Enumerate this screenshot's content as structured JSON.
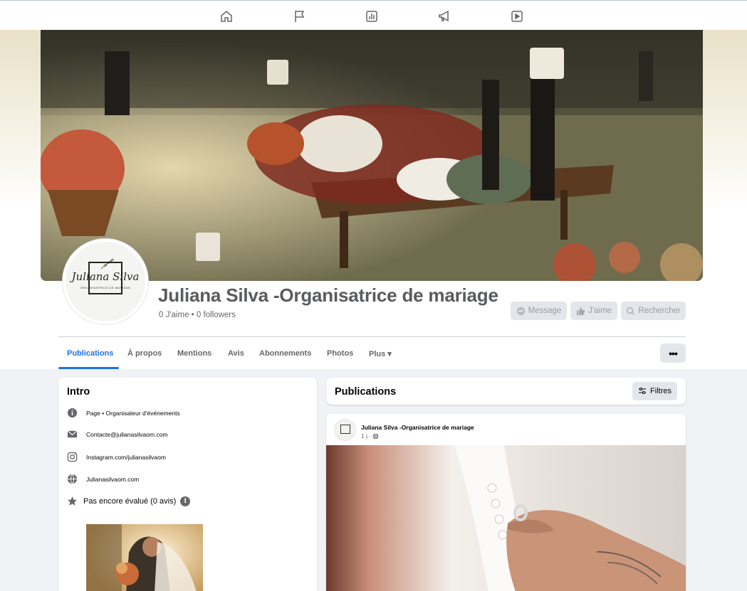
{
  "topnav": {
    "items": [
      {
        "name": "home-icon"
      },
      {
        "name": "flag-icon"
      },
      {
        "name": "insights-icon"
      },
      {
        "name": "megaphone-icon"
      },
      {
        "name": "video-icon"
      }
    ]
  },
  "page": {
    "name": "Juliana Silva -Organisatrice de mariage",
    "stats": "0 J'aime • 0 followers",
    "logo_script": "Juliana Silva",
    "logo_sub": "ORGANISATRICE DE MARIAGE"
  },
  "actions": {
    "message_label": "Message",
    "like_label": "J'aime",
    "search_label": "Rechercher"
  },
  "tabs": [
    {
      "label": "Publications",
      "active": true
    },
    {
      "label": "À propos"
    },
    {
      "label": "Mentions"
    },
    {
      "label": "Avis"
    },
    {
      "label": "Abonnements"
    },
    {
      "label": "Photos"
    },
    {
      "label": "Plus ▾"
    }
  ],
  "more_label": "•••",
  "intro": {
    "title": "Intro",
    "rows": [
      {
        "icon": "info-icon",
        "text": "Page • Organisateur d'événements"
      },
      {
        "icon": "mail-icon",
        "text": "Contacte@julianasilvaom.com"
      },
      {
        "icon": "instagram-icon",
        "text": "Instagram.com/julianasilvaom"
      },
      {
        "icon": "globe-icon",
        "text": "Julianasilvaom.com"
      }
    ],
    "rating": "Pas encore évalué (0 avis)",
    "rating_info": "i"
  },
  "publications": {
    "title": "Publications",
    "filter_label": "Filtres"
  },
  "post": {
    "author": "Juliana Silva -Organisatrice de mariage",
    "time": "1 j ·"
  },
  "colors": {
    "accent": "#1b74e4",
    "background": "#f0f2f5",
    "secondary_text": "#65676b",
    "button_bg": "#e4e6eb"
  }
}
